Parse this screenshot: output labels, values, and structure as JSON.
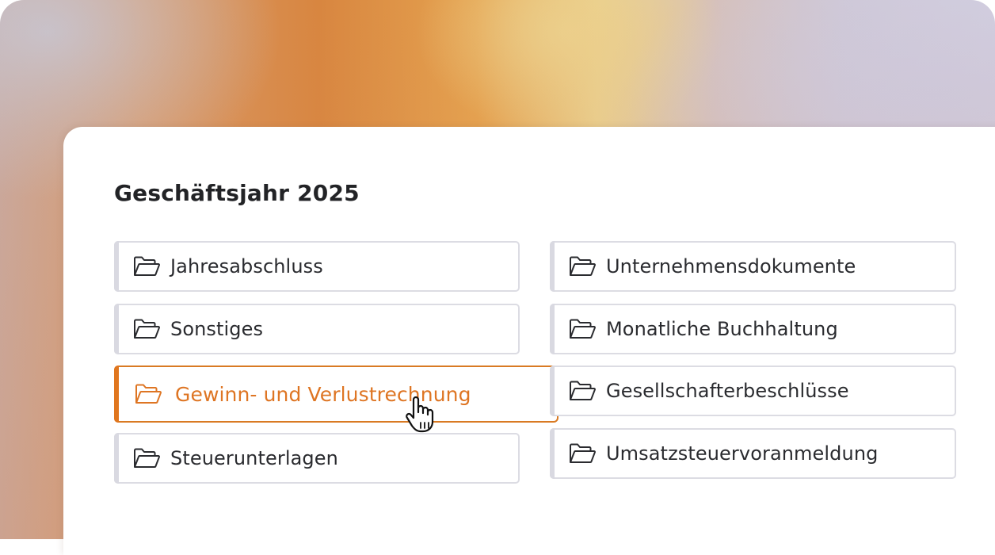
{
  "page": {
    "title": "Geschäftsjahr 2025"
  },
  "folders_left": [
    {
      "label": "Jahresabschluss",
      "icon": "folder-open-icon",
      "active": false
    },
    {
      "label": "Sonstiges",
      "icon": "folder-open-icon",
      "active": false
    },
    {
      "label": "Gewinn- und Verlustrechnung",
      "icon": "folder-open-icon",
      "active": true
    },
    {
      "label": "Steuerunterlagen",
      "icon": "folder-open-icon",
      "active": false
    }
  ],
  "folders_right": [
    {
      "label": "Unternehmensdokumente",
      "icon": "folder-open-icon",
      "active": false
    },
    {
      "label": "Monatliche Buchhaltung",
      "icon": "folder-open-icon",
      "active": false
    },
    {
      "label": "Gesellschafterbeschlüsse",
      "icon": "folder-open-icon",
      "active": false
    },
    {
      "label": "Umsatzsteuervoranmeldung",
      "icon": "folder-open-icon",
      "active": false
    }
  ],
  "colors": {
    "accent": "#de7523",
    "text": "#2a2b2f",
    "border": "#dcdce3"
  },
  "cursor": {
    "icon": "hand-pointer-icon"
  }
}
